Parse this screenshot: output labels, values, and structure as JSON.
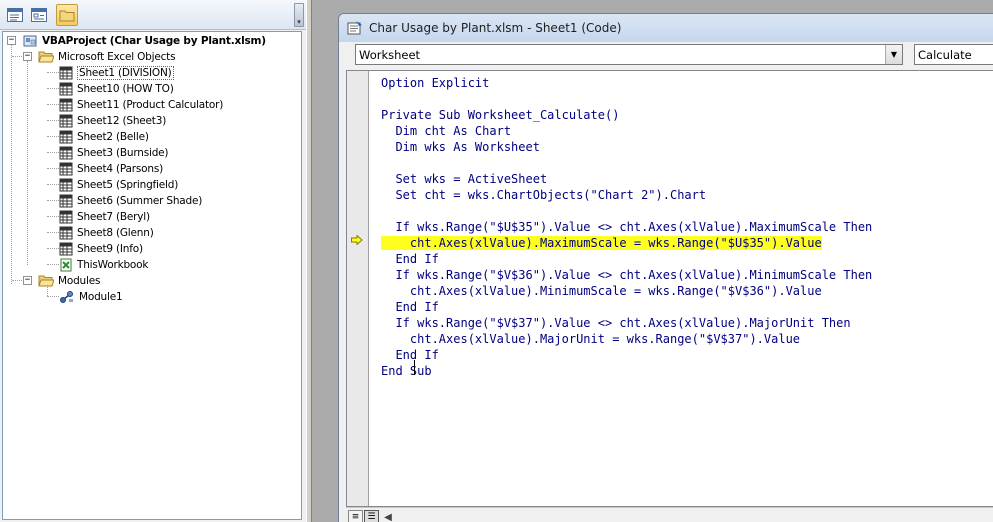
{
  "project_explorer": {
    "toolbar": {
      "view_code_icon": "view-code-icon",
      "view_object_icon": "view-object-icon",
      "toggle_folders_icon": "toggle-folders-icon"
    },
    "root": {
      "label": "VBAProject (Char Usage by Plant.xlsm)",
      "expander": "−"
    },
    "folders": [
      {
        "label": "Microsoft Excel Objects",
        "expander": "−",
        "items": [
          {
            "label": "Sheet1 (DIVISION)",
            "icon": "worksheet-icon",
            "selected": true
          },
          {
            "label": "Sheet10 (HOW TO)",
            "icon": "worksheet-icon"
          },
          {
            "label": "Sheet11 (Product Calculator)",
            "icon": "worksheet-icon"
          },
          {
            "label": "Sheet12 (Sheet3)",
            "icon": "worksheet-icon"
          },
          {
            "label": "Sheet2 (Belle)",
            "icon": "worksheet-icon"
          },
          {
            "label": "Sheet3 (Burnside)",
            "icon": "worksheet-icon"
          },
          {
            "label": "Sheet4 (Parsons)",
            "icon": "worksheet-icon"
          },
          {
            "label": "Sheet5 (Springfield)",
            "icon": "worksheet-icon"
          },
          {
            "label": "Sheet6 (Summer Shade)",
            "icon": "worksheet-icon"
          },
          {
            "label": "Sheet7 (Beryl)",
            "icon": "worksheet-icon"
          },
          {
            "label": "Sheet8 (Glenn)",
            "icon": "worksheet-icon"
          },
          {
            "label": "Sheet9 (Info)",
            "icon": "worksheet-icon"
          },
          {
            "label": "ThisWorkbook",
            "icon": "workbook-icon"
          }
        ]
      },
      {
        "label": "Modules",
        "expander": "−",
        "items": [
          {
            "label": "Module1",
            "icon": "module-icon"
          }
        ]
      }
    ]
  },
  "code_window": {
    "title": "Char Usage by Plant.xlsm - Sheet1 (Code)",
    "object_combo": {
      "value": "Worksheet",
      "arrow": "▼"
    },
    "procedure_combo": {
      "value": "Calculate"
    },
    "code_lines": [
      "Option Explicit",
      "",
      "Private Sub Worksheet_Calculate()",
      "  Dim cht As Chart",
      "  Dim wks As Worksheet",
      "",
      "  Set wks = ActiveSheet",
      "  Set cht = wks.ChartObjects(\"Chart 2\").Chart",
      "",
      "  If wks.Range(\"$U$35\").Value <> cht.Axes(xlValue).MaximumScale Then",
      "    cht.Axes(xlValue).MaximumScale = wks.Range(\"$U$35\").Value",
      "  End If",
      "  If wks.Range(\"$V$36\").Value <> cht.Axes(xlValue).MinimumScale Then",
      "    cht.Axes(xlValue).MinimumScale = wks.Range(\"$V$36\").Value",
      "  End If",
      "  If wks.Range(\"$V$37\").Value <> cht.Axes(xlValue).MajorUnit Then",
      "    cht.Axes(xlValue).MajorUnit = wks.Range(\"$V$37\").Value",
      "  End If",
      "End Sub"
    ],
    "highlighted_line": 10,
    "highlight_color": "#ffff1f",
    "code_color": "#00007f",
    "execution_marker_icon": "execution-pointer-icon",
    "bottom": {
      "procedure_view_icon": "procedure-view-icon",
      "full_module_view_icon": "full-module-view-icon",
      "scroll_left_glyph": "◀"
    }
  }
}
